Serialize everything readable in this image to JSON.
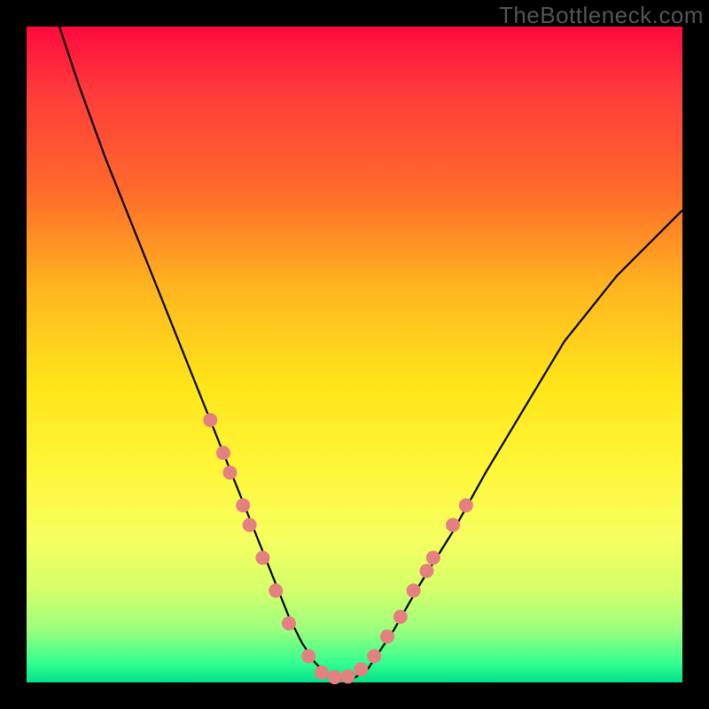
{
  "watermark": "TheBottleneck.com",
  "chart_data": {
    "type": "line",
    "title": "",
    "xlabel": "",
    "ylabel": "",
    "xlim": [
      0,
      100
    ],
    "ylim": [
      0,
      100
    ],
    "grid": false,
    "series": [
      {
        "name": "curve",
        "x": [
          5,
          8,
          12,
          16,
          20,
          24,
          28,
          32,
          34,
          36,
          38,
          40,
          42,
          44,
          46,
          48,
          50,
          52,
          56,
          60,
          65,
          70,
          76,
          82,
          90,
          100
        ],
        "y": [
          100,
          91,
          80,
          70,
          60,
          50,
          40,
          30,
          25,
          20,
          15,
          10,
          6,
          3,
          1,
          0.5,
          0.7,
          2,
          8,
          15,
          23,
          32,
          42,
          52,
          62,
          72
        ],
        "color": "#000000"
      }
    ],
    "annotations": {
      "dots_color": "#e58080",
      "dots": [
        {
          "x": 28,
          "y": 40
        },
        {
          "x": 30,
          "y": 35
        },
        {
          "x": 31,
          "y": 32
        },
        {
          "x": 33,
          "y": 27
        },
        {
          "x": 34,
          "y": 24
        },
        {
          "x": 36,
          "y": 19
        },
        {
          "x": 38,
          "y": 14
        },
        {
          "x": 40,
          "y": 9
        },
        {
          "x": 43,
          "y": 4
        },
        {
          "x": 45,
          "y": 1.5
        },
        {
          "x": 47,
          "y": 0.8
        },
        {
          "x": 49,
          "y": 0.9
        },
        {
          "x": 51,
          "y": 2
        },
        {
          "x": 53,
          "y": 4
        },
        {
          "x": 55,
          "y": 7
        },
        {
          "x": 57,
          "y": 10
        },
        {
          "x": 59,
          "y": 14
        },
        {
          "x": 61,
          "y": 17
        },
        {
          "x": 62,
          "y": 19
        },
        {
          "x": 65,
          "y": 24
        },
        {
          "x": 67,
          "y": 27
        }
      ]
    }
  }
}
